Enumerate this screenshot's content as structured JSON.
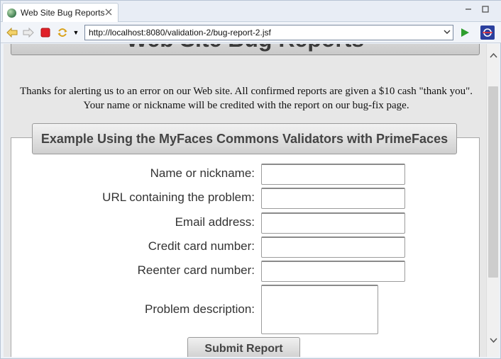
{
  "tab": {
    "title": "Web Site Bug Reports",
    "close": "⊠"
  },
  "window_controls": {
    "minimize": "🗕",
    "maximize": "🗖"
  },
  "toolbar": {
    "back_icon": "back-arrow-icon",
    "forward_icon": "forward-arrow-icon",
    "stop_icon": "stop-icon",
    "refresh_icon": "refresh-icon",
    "url": "http://localhost:8080/validation-2/bug-report-2.jsf",
    "go_icon": "go-play-icon",
    "browser_icon": "browser-logo-icon"
  },
  "page": {
    "header_title": "Web Site Bug Reports",
    "intro": "Thanks for alerting us to an error on our Web site. All confirmed reports are given a $10 cash \"thank you\". Your name or nickname will be credited with the report on our bug-fix page.",
    "panel_title": "Example Using the MyFaces Commons Validators with PrimeFaces",
    "fields": [
      {
        "label": "Name or nickname:",
        "value": ""
      },
      {
        "label": "URL containing the problem:",
        "value": ""
      },
      {
        "label": "Email address:",
        "value": ""
      },
      {
        "label": "Credit card number:",
        "value": ""
      },
      {
        "label": "Reenter card number:",
        "value": ""
      },
      {
        "label": "Problem description:",
        "value": ""
      }
    ],
    "submit_label": "Submit Report"
  },
  "colors": {
    "accent_stop": "#e0212a",
    "go_green": "#2e9e2e"
  }
}
